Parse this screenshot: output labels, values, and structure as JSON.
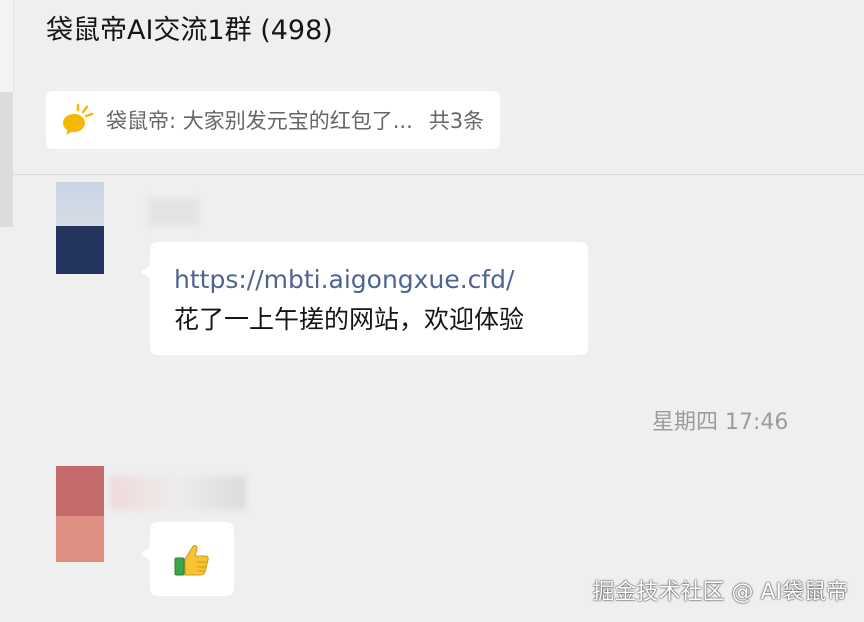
{
  "header": {
    "title": "袋鼠帝AI交流1群 (498)"
  },
  "pinned": {
    "icon": "chat-bubble-icon",
    "text": "袋鼠帝: 大家别发元宝的红包了...",
    "count": "共3条",
    "accent_color": "#f5b800"
  },
  "messages": [
    {
      "link": "https://mbti.aigongxue.cfd/",
      "text": "花了一上午搓的网站，欢迎体验",
      "link_color": "#506492"
    },
    {
      "emoji": "thumbs-up-icon"
    }
  ],
  "timestamp": "星期四 17:46",
  "watermark": "掘金技术社区 @ AI袋鼠帝"
}
